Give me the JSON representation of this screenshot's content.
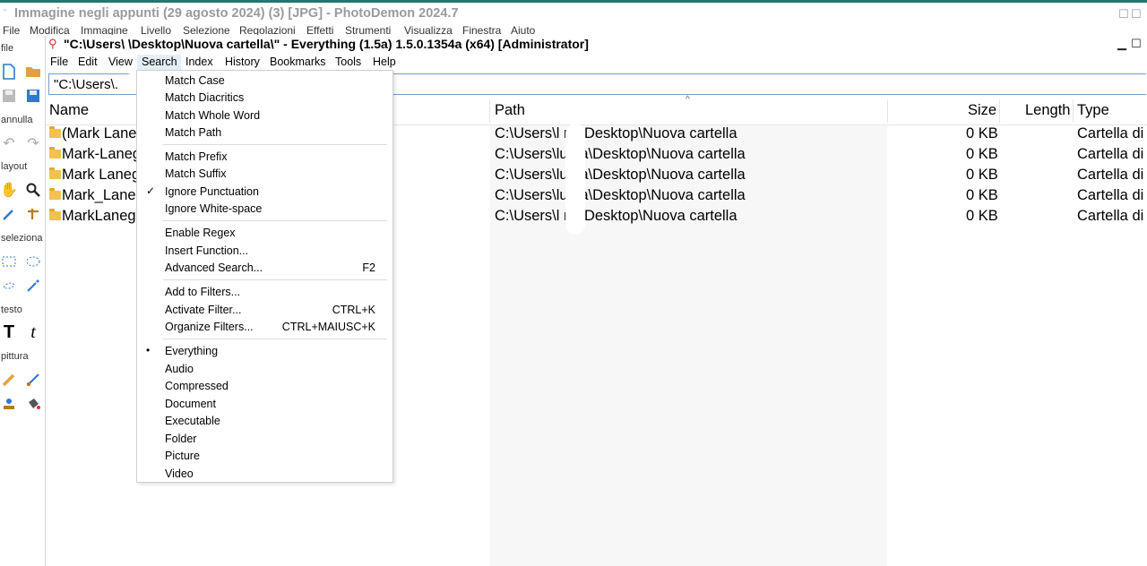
{
  "photodemon": {
    "title": "Immagine negli appunti (29 agosto 2024) (3) [JPG]  -  PhotoDemon 2024.7",
    "menu": [
      "File",
      "Modifica",
      "Immagine",
      "Livello",
      "Selezione",
      "Regolazioni",
      "Effetti",
      "Strumenti",
      "Visualizza",
      "Finestra",
      "Aiuto"
    ],
    "toolbox": {
      "file_label": "file",
      "annulla_label": "annulla",
      "layout_label": "layout",
      "seleziona_label": "seleziona",
      "testo_label": "testo",
      "pittura_label": "pittura"
    }
  },
  "everything": {
    "title": "\"C:\\Users\\         \\Desktop\\Nuova cartella\\\"  - Everything (1.5a) 1.5.0.1354a (x64) [Administrator]",
    "menu": [
      "File",
      "Edit",
      "View",
      "Search",
      "Index",
      "History",
      "Bookmarks",
      "Tools",
      "Help"
    ],
    "search_value": "\"C:\\Users\\.",
    "columns": {
      "name": "Name",
      "path": "Path",
      "size": "Size",
      "length": "Length",
      "type": "Type"
    },
    "rows": [
      {
        "name": "(Mark Lane",
        "path": "C:\\Users\\l      na\\Desktop\\Nuova cartella",
        "size": "0 KB",
        "type": "Cartella di"
      },
      {
        "name": "Mark-Laneg",
        "path": "C:\\Users\\lu     na\\Desktop\\Nuova cartella",
        "size": "0 KB",
        "type": "Cartella di"
      },
      {
        "name": "Mark Laneg",
        "path": "C:\\Users\\lu     na\\Desktop\\Nuova cartella",
        "size": "0 KB",
        "type": "Cartella di"
      },
      {
        "name": "Mark_Laneg",
        "path": "C:\\Users\\lu     na\\Desktop\\Nuova cartella",
        "size": "0 KB",
        "type": "Cartella di"
      },
      {
        "name": "MarkLaneg",
        "path": "C:\\Users\\l      na\\Desktop\\Nuova cartella",
        "size": "0 KB",
        "type": "Cartella di"
      }
    ]
  },
  "search_menu": {
    "items": [
      {
        "label": "Match Case",
        "shortcut": "",
        "mark": ""
      },
      {
        "label": "Match Diacritics",
        "shortcut": "",
        "mark": ""
      },
      {
        "label": "Match Whole Word",
        "shortcut": "",
        "mark": ""
      },
      {
        "label": "Match Path",
        "shortcut": "",
        "mark": ""
      },
      {
        "label": "Match Prefix",
        "shortcut": "",
        "mark": ""
      },
      {
        "label": "Match Suffix",
        "shortcut": "",
        "mark": ""
      },
      {
        "label": "Ignore Punctuation",
        "shortcut": "",
        "mark": "✓"
      },
      {
        "label": "Ignore White-space",
        "shortcut": "",
        "mark": ""
      },
      {
        "label": "Enable Regex",
        "shortcut": "",
        "mark": ""
      },
      {
        "label": "Insert Function...",
        "shortcut": "",
        "mark": ""
      },
      {
        "label": "Advanced Search...",
        "shortcut": "F2",
        "mark": ""
      },
      {
        "label": "Add to Filters...",
        "shortcut": "",
        "mark": ""
      },
      {
        "label": "Activate Filter...",
        "shortcut": "CTRL+K",
        "mark": ""
      },
      {
        "label": "Organize Filters...",
        "shortcut": "CTRL+MAIUSC+K",
        "mark": ""
      },
      {
        "label": "Everything",
        "shortcut": "",
        "mark": "•"
      },
      {
        "label": "Audio",
        "shortcut": "",
        "mark": ""
      },
      {
        "label": "Compressed",
        "shortcut": "",
        "mark": ""
      },
      {
        "label": "Document",
        "shortcut": "",
        "mark": ""
      },
      {
        "label": "Executable",
        "shortcut": "",
        "mark": ""
      },
      {
        "label": "Folder",
        "shortcut": "",
        "mark": ""
      },
      {
        "label": "Picture",
        "shortcut": "",
        "mark": ""
      },
      {
        "label": "Video",
        "shortcut": "",
        "mark": ""
      }
    ]
  }
}
